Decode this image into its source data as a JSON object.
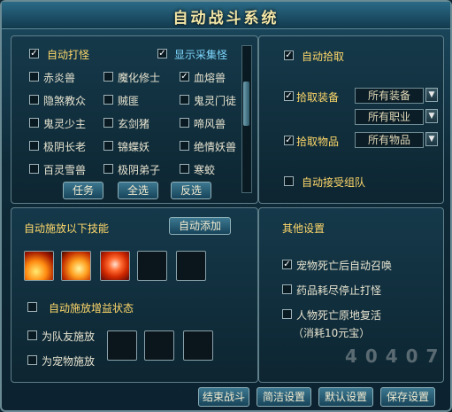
{
  "title": "自动战斗系统",
  "monster_panel": {
    "auto_fight": {
      "label": "自动打怪",
      "checked": true
    },
    "show_gather": {
      "label": "显示采集怪",
      "checked": true
    },
    "monsters": [
      {
        "label": "赤炎兽",
        "checked": false
      },
      {
        "label": "魔化修士",
        "checked": false
      },
      {
        "label": "血熔兽",
        "checked": true
      },
      {
        "label": "隐煞教众",
        "checked": false
      },
      {
        "label": "贼匪",
        "checked": false
      },
      {
        "label": "鬼灵门徒",
        "checked": false
      },
      {
        "label": "鬼灵少主",
        "checked": false
      },
      {
        "label": "玄剑猪",
        "checked": false
      },
      {
        "label": "啼风兽",
        "checked": false
      },
      {
        "label": "极阴长老",
        "checked": false
      },
      {
        "label": "锦蝶妖",
        "checked": false
      },
      {
        "label": "绝情妖兽",
        "checked": false
      },
      {
        "label": "百灵雪兽",
        "checked": false
      },
      {
        "label": "极阴弟子",
        "checked": false
      },
      {
        "label": "寒蛟",
        "checked": false
      }
    ],
    "buttons": {
      "any": "任务",
      "all": "全选",
      "invert": "反选"
    }
  },
  "pickup_panel": {
    "auto_pick": {
      "label": "自动拾取",
      "checked": true
    },
    "pick_equip": {
      "label": "拾取装备",
      "checked": true
    },
    "equip_dropdown": "所有装备",
    "job_dropdown": "所有职业",
    "pick_items": {
      "label": "拾取物品",
      "checked": true
    },
    "items_dropdown": "所有物品",
    "auto_team": {
      "label": "自动接受组队",
      "checked": false
    }
  },
  "skill_panel": {
    "heading": "自动施放以下技能",
    "auto_add": "自动添加",
    "buff_state": {
      "label": "自动施放增益状态",
      "checked": false
    },
    "for_team": {
      "label": "为队友施放",
      "checked": false
    },
    "for_pet": {
      "label": "为宠物施放",
      "checked": false
    }
  },
  "other_panel": {
    "heading": "其他设置",
    "pet_summon": {
      "label": "宠物死亡后自动召唤",
      "checked": true
    },
    "stop_fight": {
      "label": "药品耗尽停止打怪",
      "checked": false
    },
    "revive": {
      "label": "人物死亡原地复活",
      "checked": false
    },
    "cost": "（消耗10元宝）"
  },
  "footer": {
    "end_fight": "结束战斗",
    "simple": "简洁设置",
    "default": "默认设置",
    "save": "保存设置",
    "watermark": "4 0 4 0 7"
  }
}
